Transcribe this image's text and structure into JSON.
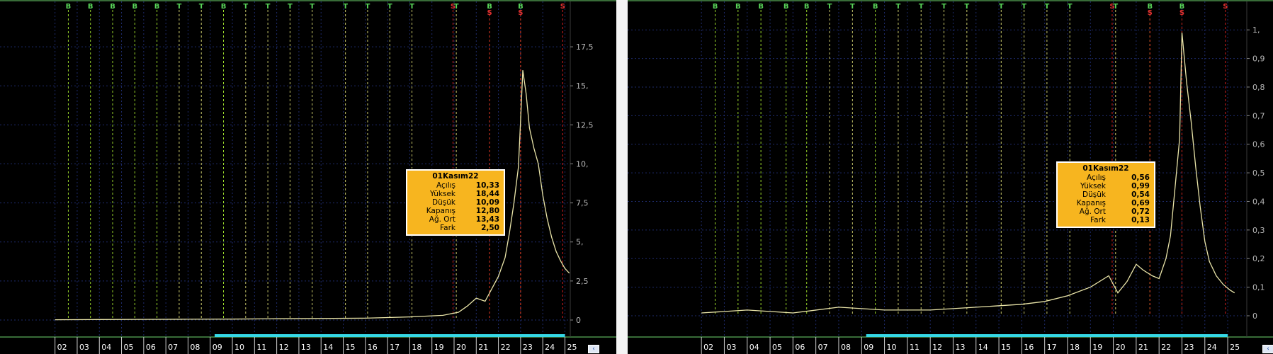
{
  "colors": {
    "background": "#000000",
    "price_line": "#e9e4a8",
    "buy_line": "#9ad82a",
    "sell_line": "#d21e1e",
    "neutral_line": "#c9c86a",
    "grid": "#1e2b6b",
    "axis_text": "#b9b9b9",
    "signal_text_buy": "#58d458",
    "signal_text_sell": "#e03030",
    "tooltip_bg": "#f7b51f",
    "year_bar": "#35d8e6",
    "frame": "#6fd86f"
  },
  "icons": {
    "nav": "chevron-left-icon"
  },
  "chart_data": [
    {
      "type": "line",
      "y_ticks": [
        "0",
        "2,5",
        "5,",
        "7,5",
        "10,",
        "12,5",
        "15,",
        "17,5"
      ],
      "ylim": [
        0,
        19.5
      ],
      "x_ticks": [
        "02",
        "03",
        "04",
        "05",
        "06",
        "07",
        "08",
        "09",
        "10",
        "11",
        "12",
        "13",
        "14",
        "15",
        "16",
        "17",
        "18",
        "19",
        "20",
        "21",
        "22",
        "23",
        "24",
        "25"
      ],
      "xlim": [
        2001.5,
        2025.4
      ],
      "signals": [
        {
          "label": "B",
          "x": 2002.6
        },
        {
          "label": "B",
          "x": 2003.6
        },
        {
          "label": "B",
          "x": 2004.6
        },
        {
          "label": "B",
          "x": 2005.6
        },
        {
          "label": "B",
          "x": 2006.6
        },
        {
          "label": "T",
          "x": 2007.6
        },
        {
          "label": "T",
          "x": 2008.6
        },
        {
          "label": "B",
          "x": 2009.6
        },
        {
          "label": "T",
          "x": 2010.6
        },
        {
          "label": "T",
          "x": 2011.6
        },
        {
          "label": "T",
          "x": 2012.6
        },
        {
          "label": "T",
          "x": 2013.6
        },
        {
          "label": "T",
          "x": 2015.1
        },
        {
          "label": "T",
          "x": 2016.1
        },
        {
          "label": "T",
          "x": 2017.1
        },
        {
          "label": "T",
          "x": 2018.1
        },
        {
          "label": "S",
          "x": 2019.95
        },
        {
          "label": "T",
          "x": 2020.1
        },
        {
          "label": "B",
          "x": 2021.6
        },
        {
          "label": "S",
          "x": 2021.6
        },
        {
          "label": "B",
          "x": 2023.0
        },
        {
          "label": "S",
          "x": 2023.0
        },
        {
          "label": "S",
          "x": 2024.9
        }
      ],
      "series": [
        {
          "x": [
            2002,
            2004,
            2006,
            2008,
            2010,
            2012,
            2014,
            2016,
            2018,
            2019.5,
            2020.2,
            2020.6,
            2021.0,
            2021.4,
            2021.7,
            2022.0,
            2022.3,
            2022.5,
            2022.7,
            2022.9,
            2023.0,
            2023.1,
            2023.25,
            2023.4,
            2023.6,
            2023.8,
            2024.0,
            2024.2,
            2024.4,
            2024.6,
            2024.8,
            2025.0,
            2025.2
          ],
          "y": [
            0.02,
            0.03,
            0.04,
            0.05,
            0.06,
            0.08,
            0.1,
            0.12,
            0.2,
            0.3,
            0.5,
            0.9,
            1.4,
            1.2,
            2.0,
            2.8,
            4.0,
            5.6,
            7.5,
            9.8,
            12.8,
            16.0,
            14.5,
            12.3,
            11.0,
            10.0,
            8.0,
            6.5,
            5.3,
            4.4,
            3.8,
            3.3,
            3.0
          ]
        }
      ],
      "tooltip": {
        "date": "01Kasım22",
        "rows": [
          {
            "label": "Açılış",
            "value": "10,33"
          },
          {
            "label": "Yüksek",
            "value": "18,44"
          },
          {
            "label": "Düşük",
            "value": "10,09"
          },
          {
            "label": "Kapanış",
            "value": "12,80"
          },
          {
            "label": "Ağ. Ort",
            "value": "13,43"
          },
          {
            "label": "Fark",
            "value": "2,50"
          }
        ]
      }
    },
    {
      "type": "line",
      "y_ticks": [
        "0",
        "0,1",
        "0,2",
        "0,3",
        "0,4",
        "0,5",
        "0,6",
        "0,7",
        "0,8",
        "0,9",
        "1,"
      ],
      "ylim": [
        0,
        1.05
      ],
      "x_ticks": [
        "02",
        "03",
        "04",
        "05",
        "06",
        "07",
        "08",
        "09",
        "10",
        "11",
        "12",
        "13",
        "14",
        "15",
        "16",
        "17",
        "18",
        "19",
        "20",
        "21",
        "22",
        "23",
        "24",
        "25"
      ],
      "xlim": [
        2001.5,
        2025.4
      ],
      "signals": [
        {
          "label": "B",
          "x": 2002.6
        },
        {
          "label": "B",
          "x": 2003.6
        },
        {
          "label": "B",
          "x": 2004.6
        },
        {
          "label": "B",
          "x": 2005.7
        },
        {
          "label": "B",
          "x": 2006.6
        },
        {
          "label": "T",
          "x": 2007.6
        },
        {
          "label": "T",
          "x": 2008.6
        },
        {
          "label": "B",
          "x": 2009.6
        },
        {
          "label": "T",
          "x": 2010.6
        },
        {
          "label": "T",
          "x": 2011.6
        },
        {
          "label": "T",
          "x": 2012.6
        },
        {
          "label": "T",
          "x": 2013.6
        },
        {
          "label": "T",
          "x": 2015.1
        },
        {
          "label": "T",
          "x": 2016.1
        },
        {
          "label": "T",
          "x": 2017.1
        },
        {
          "label": "T",
          "x": 2018.1
        },
        {
          "label": "S",
          "x": 2019.95
        },
        {
          "label": "T",
          "x": 2020.1
        },
        {
          "label": "B",
          "x": 2021.6
        },
        {
          "label": "S",
          "x": 2021.6
        },
        {
          "label": "B",
          "x": 2023.0
        },
        {
          "label": "S",
          "x": 2023.0
        },
        {
          "label": "S",
          "x": 2024.9
        }
      ],
      "series": [
        {
          "x": [
            2002,
            2004,
            2006,
            2008,
            2010,
            2012,
            2014,
            2016,
            2017,
            2018,
            2019,
            2019.8,
            2020.2,
            2020.6,
            2021.0,
            2021.3,
            2021.7,
            2022.0,
            2022.3,
            2022.5,
            2022.7,
            2022.9,
            2023.0,
            2023.2,
            2023.4,
            2023.6,
            2023.8,
            2024.0,
            2024.2,
            2024.5,
            2024.8,
            2025.1,
            2025.3
          ],
          "y": [
            0.01,
            0.02,
            0.01,
            0.03,
            0.02,
            0.02,
            0.03,
            0.04,
            0.05,
            0.07,
            0.1,
            0.14,
            0.08,
            0.12,
            0.18,
            0.16,
            0.14,
            0.13,
            0.2,
            0.28,
            0.45,
            0.62,
            0.99,
            0.82,
            0.68,
            0.52,
            0.38,
            0.26,
            0.19,
            0.14,
            0.11,
            0.09,
            0.08
          ]
        }
      ],
      "tooltip": {
        "date": "01Kasım22",
        "rows": [
          {
            "label": "Açılış",
            "value": "0,56"
          },
          {
            "label": "Yüksek",
            "value": "0,99"
          },
          {
            "label": "Düşük",
            "value": "0,54"
          },
          {
            "label": "Kapanış",
            "value": "0,69"
          },
          {
            "label": "Ağ. Ort",
            "value": "0,72"
          },
          {
            "label": "Fark",
            "value": "0,13"
          }
        ]
      }
    }
  ]
}
